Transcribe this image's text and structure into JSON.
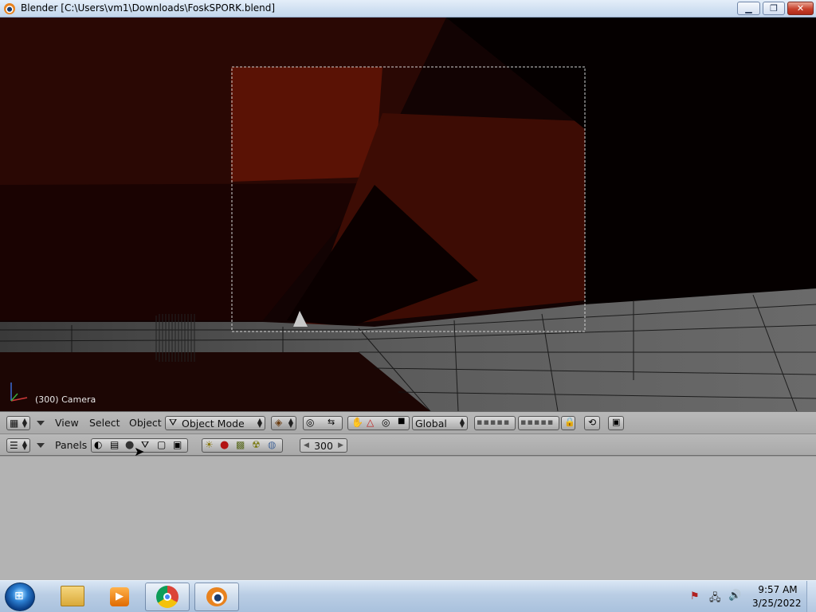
{
  "window": {
    "title": "Blender [C:\\Users\\vm1\\Downloads\\FoskSPORK.blend]",
    "minimize": "▁",
    "maximize": "❐",
    "close": "✕"
  },
  "viewport": {
    "camera_label": "(300) Camera"
  },
  "view_header": {
    "menus": [
      "View",
      "Select",
      "Object"
    ],
    "mode": "Object Mode",
    "orientation": "Global"
  },
  "buttons_header": {
    "panels_label": "Panels",
    "frame": "300"
  },
  "taskbar": {
    "time": "9:57 AM",
    "date": "3/25/2022"
  },
  "colors": {
    "viewport_bg": "#140505",
    "header_bg": "#afafaf",
    "buttons_bg": "#b3b3b3"
  }
}
